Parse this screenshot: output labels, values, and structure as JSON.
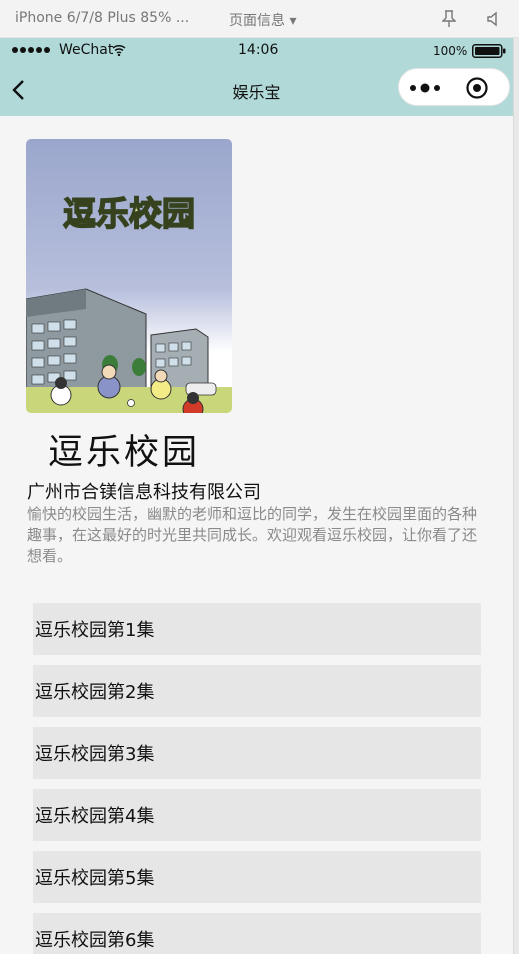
{
  "devtools": {
    "device_label": "iPhone 6/7/8 Plus 85% ...",
    "page_info_label": "页面信息 ▾"
  },
  "status_bar": {
    "carrier": "WeChat",
    "time": "14:06",
    "battery": "100%"
  },
  "nav": {
    "title": "娱乐宝"
  },
  "show": {
    "poster_title": "逗乐校园",
    "title": "逗乐校园",
    "company": "广州市合镁信息科技有限公司",
    "description": "愉快的校园生活，幽默的老师和逗比的同学，发生在校园里面的各种趣事，在这最好的时光里共同成长。欢迎观看逗乐校园，让你看了还想看。"
  },
  "episodes": [
    {
      "label": "逗乐校园第1集"
    },
    {
      "label": "逗乐校园第2集"
    },
    {
      "label": "逗乐校园第3集"
    },
    {
      "label": "逗乐校园第4集"
    },
    {
      "label": "逗乐校园第5集"
    },
    {
      "label": "逗乐校园第6集"
    }
  ],
  "colors": {
    "header_bg": "#b0d9d8",
    "content_bg": "#f5f5f5",
    "episode_bg": "#e6e6e6"
  },
  "icons": [
    "pin-icon",
    "mute-icon",
    "wifi-icon",
    "battery-icon",
    "back-icon",
    "more-icon",
    "close-target-icon"
  ]
}
